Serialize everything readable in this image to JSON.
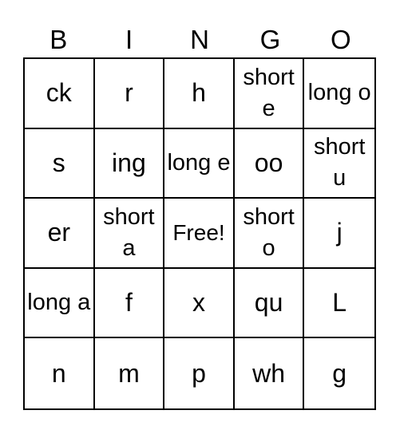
{
  "header": [
    "B",
    "I",
    "N",
    "G",
    "O"
  ],
  "rows": [
    [
      "ck",
      "r",
      "h",
      "short e",
      "long o"
    ],
    [
      "s",
      "ing",
      "long e",
      "oo",
      "short u"
    ],
    [
      "er",
      "short a",
      "Free!",
      "short o",
      "j"
    ],
    [
      "long a",
      "f",
      "x",
      "qu",
      "L"
    ],
    [
      "n",
      "m",
      "p",
      "wh",
      "g"
    ]
  ]
}
